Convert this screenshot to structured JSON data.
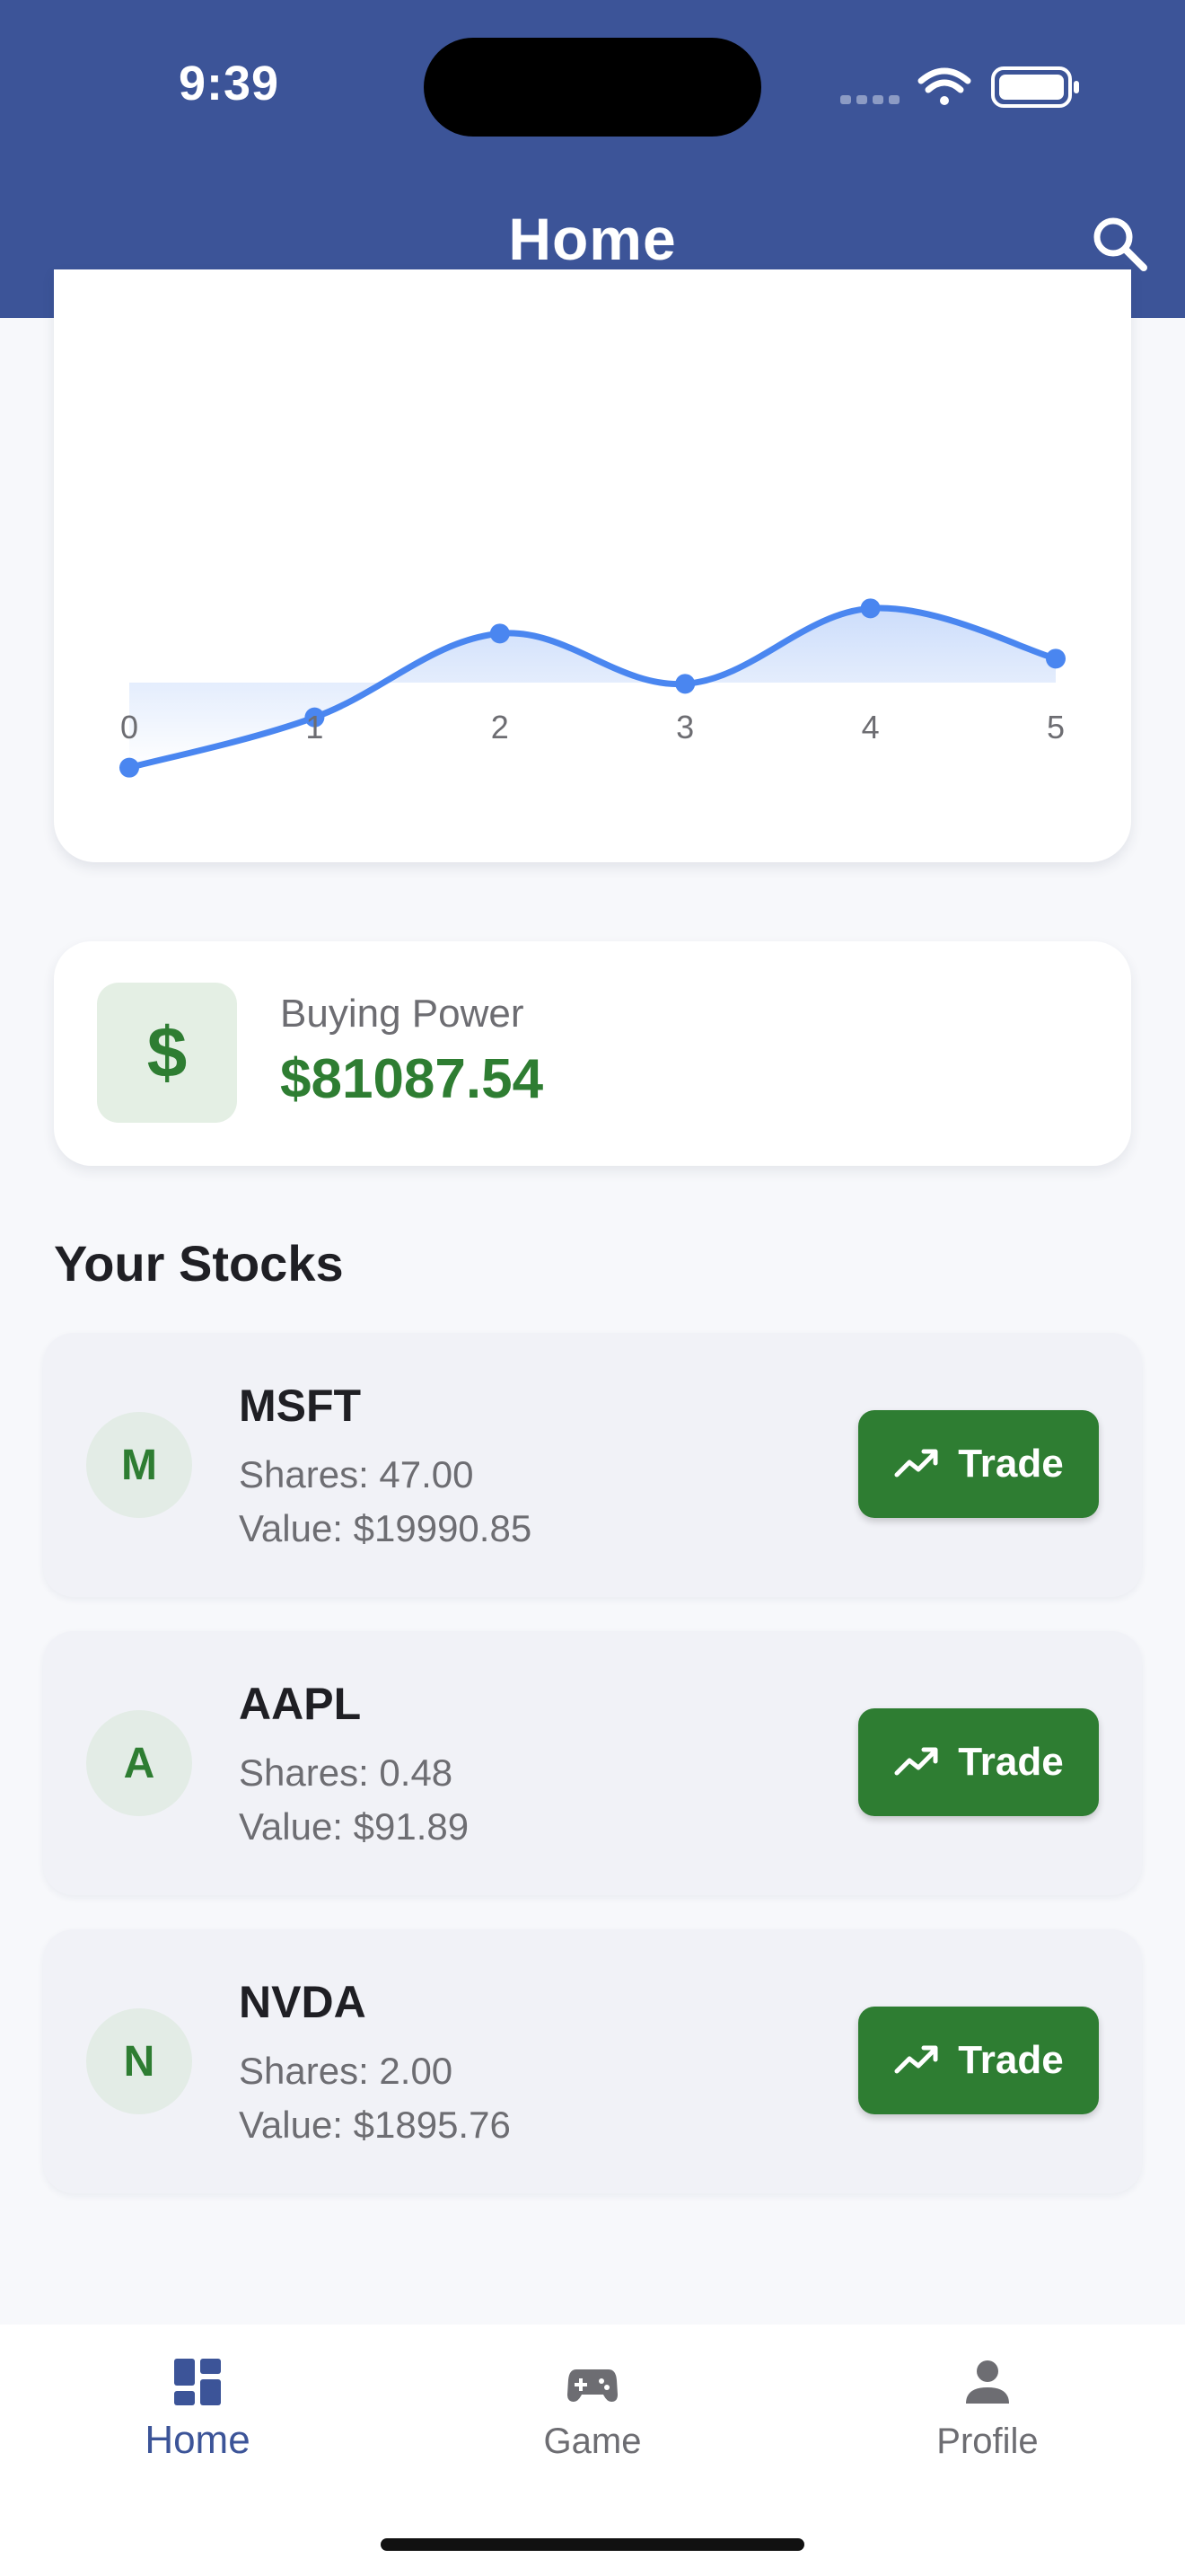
{
  "status_bar": {
    "time": "9:39"
  },
  "header": {
    "title": "Home",
    "search_icon": "search-icon"
  },
  "chart_data": {
    "type": "area",
    "x": [
      0,
      1,
      2,
      3,
      4,
      5
    ],
    "series": [
      {
        "values": [
          41,
          44,
          49,
          46,
          50.5,
          47.5
        ],
        "color": "#4a86f0"
      }
    ],
    "tick_labels": [
      "0",
      "1",
      "2",
      "3",
      "4",
      "5"
    ],
    "xlim": [
      0,
      5
    ],
    "ylim": [
      30,
      60
    ],
    "grid": false
  },
  "buying_power": {
    "label": "Buying Power",
    "value": "$81087.54",
    "icon": "dollar-icon",
    "icon_glyph": "$"
  },
  "stocks_section": {
    "title": "Your Stocks"
  },
  "stocks": [
    {
      "initial": "M",
      "symbol": "MSFT",
      "shares": "Shares: 47.00",
      "value": "Value: $19990.85",
      "button": "Trade"
    },
    {
      "initial": "A",
      "symbol": "AAPL",
      "shares": "Shares: 0.48",
      "value": "Value: $91.89",
      "button": "Trade"
    },
    {
      "initial": "N",
      "symbol": "NVDA",
      "shares": "Shares: 2.00",
      "value": "Value: $1895.76",
      "button": "Trade"
    }
  ],
  "bottom_nav": {
    "items": [
      {
        "label": "Home",
        "icon": "dashboard-icon",
        "active": true
      },
      {
        "label": "Game",
        "icon": "gamepad-icon",
        "active": false
      },
      {
        "label": "Profile",
        "icon": "person-icon",
        "active": false
      }
    ]
  },
  "colors": {
    "header": "#3c5498",
    "accent_green": "#2e7d32",
    "chart_line": "#4a86f0",
    "nav_active": "#3c5498"
  }
}
